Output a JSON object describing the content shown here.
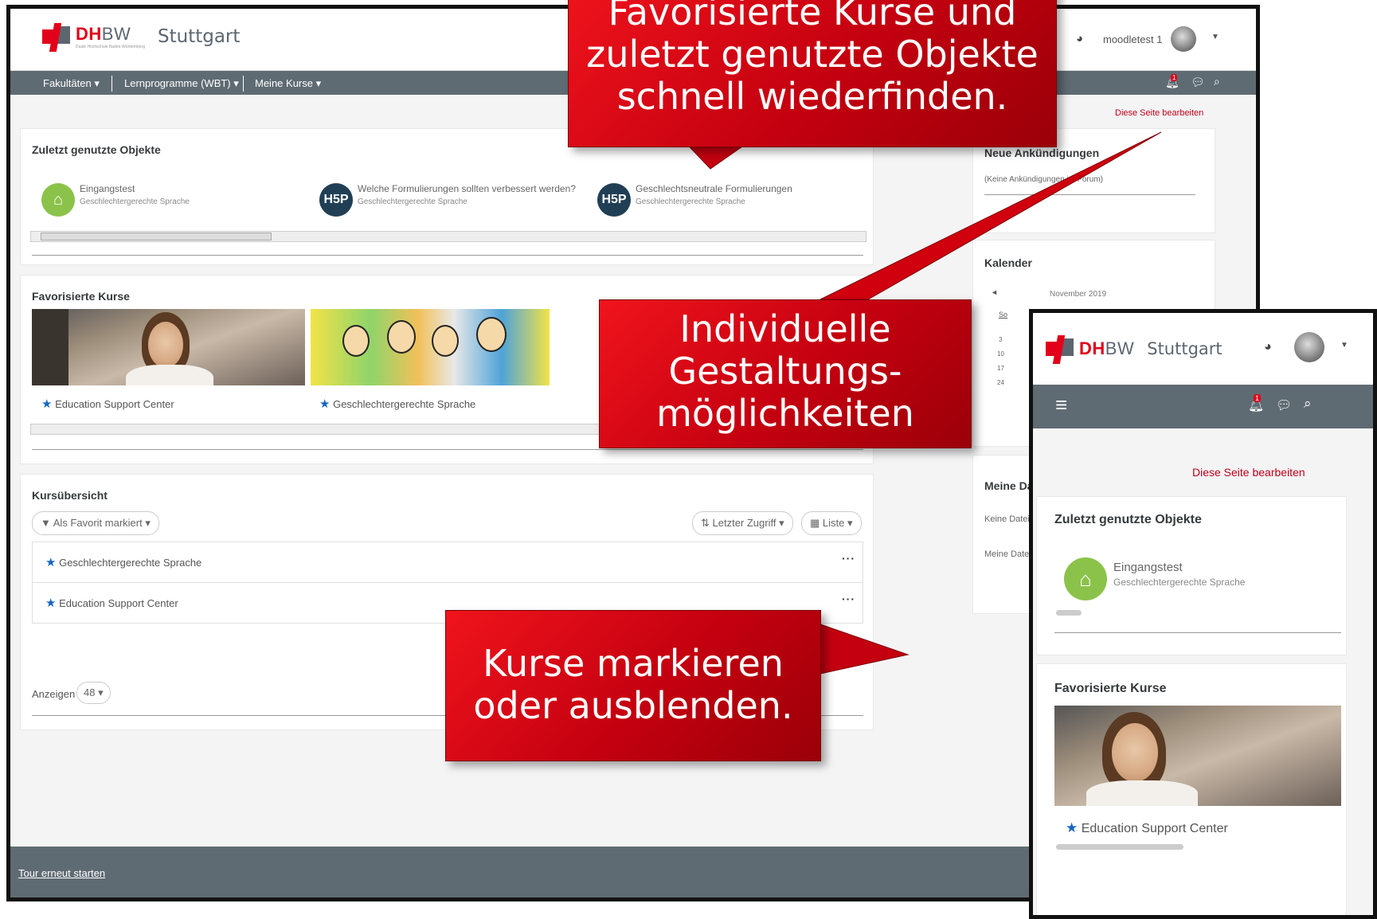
{
  "desktop": {
    "logo": {
      "dh": "DH",
      "bw": "BW",
      "sub": "Duale Hochschule Baden-Württemberg",
      "city": "Stuttgart"
    },
    "user": {
      "name": "moodletest 1"
    },
    "nav": {
      "items": [
        "Fakultäten",
        "Lernprogramme (WBT)",
        "Meine Kurse"
      ],
      "badge": "1"
    },
    "edit_link": "Diese Seite bearbeiten",
    "recent": {
      "title": "Zuletzt genutzte Objekte",
      "items": [
        {
          "title": "Eingangstest",
          "sub": "Geschlechtergerechte Sprache",
          "icon": "presentation-icon"
        },
        {
          "title": "Welche Formulierungen sollten verbessert werden?",
          "sub": "Geschlechtergerechte Sprache",
          "icon": "H5P"
        },
        {
          "title": "Geschlechtsneutrale Formulierungen",
          "sub": "Geschlechtergerechte Sprache",
          "icon": "H5P"
        }
      ]
    },
    "favorites": {
      "title": "Favorisierte Kurse",
      "items": [
        "Education Support Center",
        "Geschlechtergerechte Sprache"
      ]
    },
    "overview": {
      "title": "Kursübersicht",
      "filter": "Als Favorit markiert",
      "sort": "Letzter Zugriff",
      "view": "Liste",
      "rows": [
        "Geschlechtergerechte Sprache",
        "Education Support Center"
      ],
      "show_label": "Anzeigen",
      "show_count": "48"
    },
    "sidebar": {
      "announcements": {
        "title": "Neue Ankündigungen",
        "text": "(Keine Ankündigungen im Forum)"
      },
      "calendar": {
        "title": "Kalender",
        "month": "November 2019",
        "day_header": "So",
        "days": [
          "3",
          "10",
          "17",
          "24"
        ]
      },
      "files": {
        "title": "Meine Dateien",
        "text": "Keine Dateien",
        "link": "Meine Dateien"
      }
    },
    "footer": {
      "tour": "Tour erneut starten"
    }
  },
  "callouts": {
    "top": "Favorisierte Kurse und zuletzt genutzte Objekte schnell wiederfinden.",
    "middle": "Individuelle Gestaltungs-möglichkeiten",
    "bottom": "Kurse markieren oder ausblenden."
  },
  "mobile": {
    "logo": {
      "dh": "DH",
      "bw": "BW",
      "city": "Stuttgart"
    },
    "badge": "1",
    "edit_link": "Diese Seite bearbeiten",
    "recent_title": "Zuletzt genutzte Objekte",
    "recent_item": {
      "title": "Eingangstest",
      "sub": "Geschlechtergerechte Sprache"
    },
    "fav_title": "Favorisierte Kurse",
    "fav_item": "Education Support Center"
  },
  "colors": {
    "brand_red": "#e2001a",
    "navbar": "#5f6b73",
    "star": "#1565c0",
    "callout": "#d0000e"
  }
}
